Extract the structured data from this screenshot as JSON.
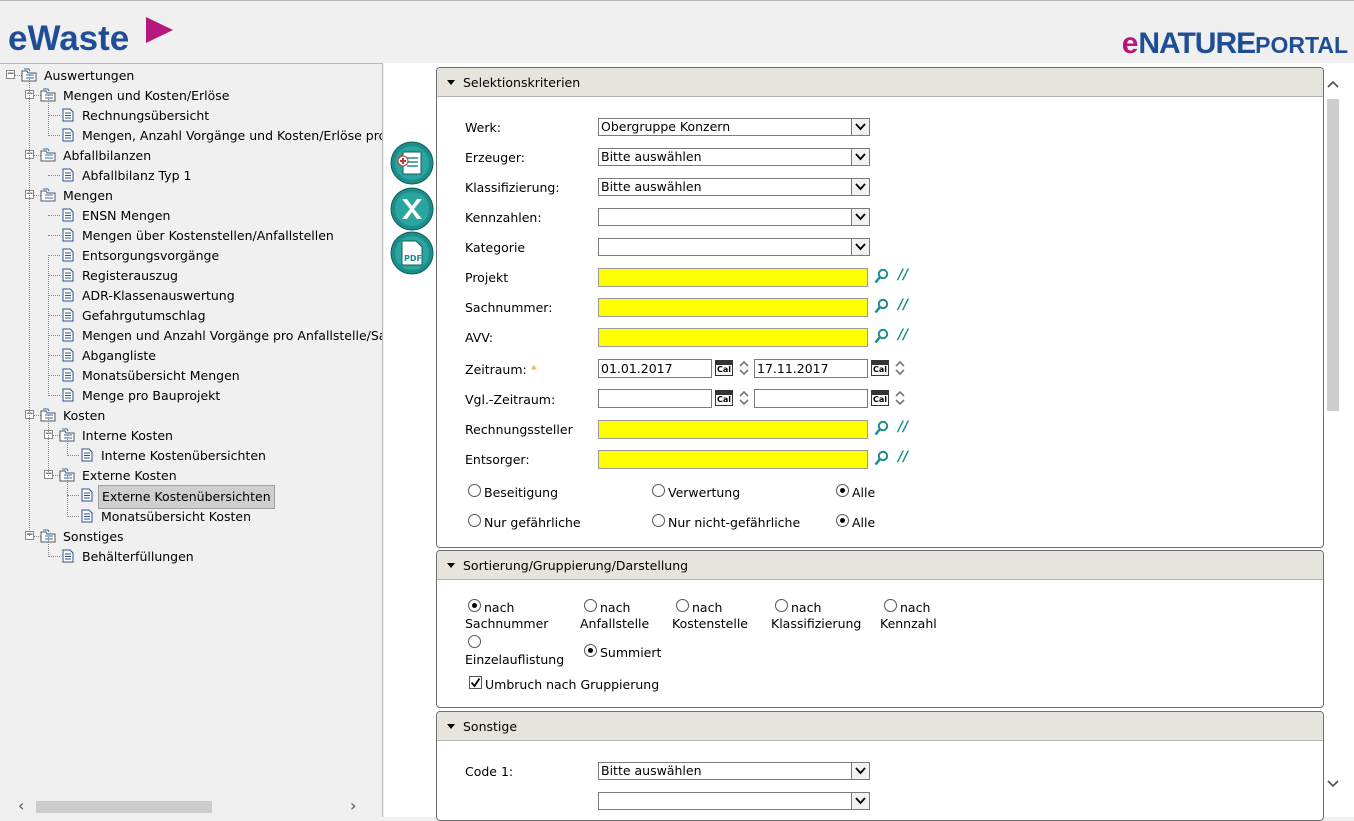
{
  "header": {
    "brand_left": "eWaste",
    "brand_right_e": "e",
    "brand_right_nature": "NATURE",
    "brand_right_portal": "PORTAL"
  },
  "tree": [
    {
      "label": "Auswertungen",
      "type": "folder",
      "level": 0
    },
    {
      "label": "Mengen und Kosten/Erlöse",
      "type": "folder",
      "level": 1
    },
    {
      "label": "Rechnungsübersicht",
      "type": "doc",
      "level": 2
    },
    {
      "label": "Mengen, Anzahl Vorgänge und Kosten/Erlöse pro",
      "type": "doc",
      "level": 2
    },
    {
      "label": "Abfallbilanzen",
      "type": "folder",
      "level": 1
    },
    {
      "label": "Abfallbilanz Typ 1",
      "type": "doc",
      "level": 2
    },
    {
      "label": "Mengen",
      "type": "folder",
      "level": 1
    },
    {
      "label": "ENSN Mengen",
      "type": "doc",
      "level": 2
    },
    {
      "label": "Mengen über Kostenstellen/Anfallstellen",
      "type": "doc",
      "level": 2
    },
    {
      "label": "Entsorgungsvorgänge",
      "type": "doc",
      "level": 2
    },
    {
      "label": "Registerauszug",
      "type": "doc",
      "level": 2
    },
    {
      "label": "ADR-Klassenauswertung",
      "type": "doc",
      "level": 2
    },
    {
      "label": "Gefahrgutumschlag",
      "type": "doc",
      "level": 2
    },
    {
      "label": "Mengen und Anzahl Vorgänge pro Anfallstelle/Sa",
      "type": "doc",
      "level": 2
    },
    {
      "label": "Abgangliste",
      "type": "doc",
      "level": 2
    },
    {
      "label": "Monatsübersicht Mengen",
      "type": "doc",
      "level": 2
    },
    {
      "label": "Menge pro Bauprojekt",
      "type": "doc",
      "level": 2
    },
    {
      "label": "Kosten",
      "type": "folder",
      "level": 1
    },
    {
      "label": "Interne Kosten",
      "type": "folder",
      "level": 2
    },
    {
      "label": "Interne Kostenübersichten",
      "type": "doc",
      "level": 3
    },
    {
      "label": "Externe Kosten",
      "type": "folder",
      "level": 2
    },
    {
      "label": "Externe Kostenübersichten",
      "type": "doc",
      "level": 3,
      "selected": true
    },
    {
      "label": "Monatsübersicht Kosten",
      "type": "doc",
      "level": 3
    },
    {
      "label": "Sonstiges",
      "type": "folder",
      "level": 1
    },
    {
      "label": "Behälterfüllungen",
      "type": "doc",
      "level": 2
    }
  ],
  "selektion": {
    "title": "Selektionskriterien",
    "werk_label": "Werk:",
    "werk_value": "Obergruppe Konzern",
    "erzeuger_label": "Erzeuger:",
    "erzeuger_value": "Bitte auswählen",
    "klass_label": "Klassifizierung:",
    "klass_value": "Bitte auswählen",
    "kennzahlen_label": "Kennzahlen:",
    "kennzahlen_value": "",
    "kategorie_label": "Kategorie",
    "kategorie_value": "",
    "projekt_label": "Projekt",
    "sachnummer_label": "Sachnummer:",
    "avv_label": "AVV:",
    "zeitraum_label": "Zeitraum:",
    "required_star": "*",
    "zeitraum_from": "01.01.2017",
    "zeitraum_to": "17.11.2017",
    "vgl_label": "Vgl.-Zeitraum:",
    "vgl_from": "",
    "vgl_to": "",
    "cal_text": "Cal",
    "rechnungssteller_label": "Rechnungssteller",
    "entsorger_label": "Entsorger:",
    "r_beseitigung": "Beseitigung",
    "r_verwertung": "Verwertung",
    "r_alle1": "Alle",
    "r_nur_gef": "Nur gefährliche",
    "r_nur_nicht_gef": "Nur nicht-gefährliche",
    "r_alle2": "Alle"
  },
  "sortierung": {
    "title": "Sortierung/Gruppierung/Darstellung",
    "o1_line1": "nach",
    "o1_line2": "Sachnummer",
    "o2_line1": "nach",
    "o2_line2": "Anfallstelle",
    "o3_line1": "nach",
    "o3_line2": "Kostenstelle",
    "o4_line1": "nach",
    "o4_line2": "Klassifizierung",
    "o5_line1": "nach",
    "o5_line2": "Kennzahl",
    "einzel": "Einzelauflistung",
    "summiert": "Summiert",
    "umbruch": "Umbruch nach Gruppierung"
  },
  "sonstige": {
    "title": "Sonstige",
    "code1_label": "Code 1:",
    "code1_value": "Bitte auswählen"
  },
  "colors": {
    "brand_blue": "#1f4e96",
    "brand_magenta": "#b5177c",
    "teal": "#1c8d88",
    "lookup_required": "#ffff00"
  },
  "icons": [
    "folder-icon",
    "document-icon",
    "report-icon",
    "excel-icon",
    "pdf-icon",
    "lookup-icon",
    "clear-icon",
    "calendar-icon",
    "spin-icon"
  ]
}
